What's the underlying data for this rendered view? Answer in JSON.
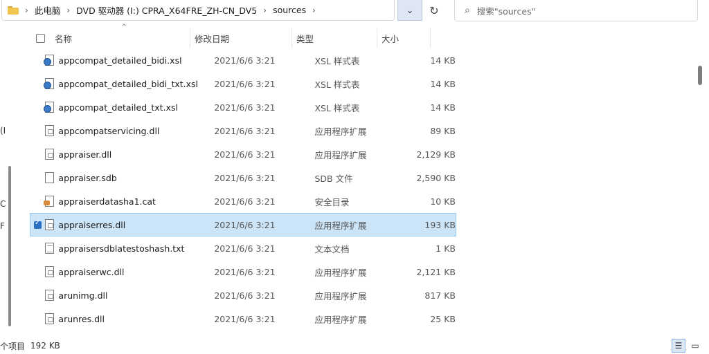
{
  "address_bar": {
    "crumbs": [
      "此电脑",
      "DVD 驱动器 (I:) CPRA_X64FRE_ZH-CN_DV5",
      "sources"
    ]
  },
  "search": {
    "placeholder": "搜索\"sources\""
  },
  "nav_fragments": [
    "(I",
    "C",
    "F"
  ],
  "columns": {
    "name": "名称",
    "date": "修改日期",
    "type": "类型",
    "size": "大小"
  },
  "files": [
    {
      "name": "appcompat_detailed_bidi.xsl",
      "date": "2021/6/6 3:21",
      "type": "XSL 样式表",
      "size": "14 KB",
      "icon": "xsl-stylesheet-icon"
    },
    {
      "name": "appcompat_detailed_bidi_txt.xsl",
      "date": "2021/6/6 3:21",
      "type": "XSL 样式表",
      "size": "14 KB",
      "icon": "xsl-stylesheet-icon"
    },
    {
      "name": "appcompat_detailed_txt.xsl",
      "date": "2021/6/6 3:21",
      "type": "XSL 样式表",
      "size": "14 KB",
      "icon": "xsl-stylesheet-icon"
    },
    {
      "name": "appcompatservicing.dll",
      "date": "2021/6/6 3:21",
      "type": "应用程序扩展",
      "size": "89 KB",
      "icon": "dll-file-icon"
    },
    {
      "name": "appraiser.dll",
      "date": "2021/6/6 3:21",
      "type": "应用程序扩展",
      "size": "2,129 KB",
      "icon": "dll-file-icon"
    },
    {
      "name": "appraiser.sdb",
      "date": "2021/6/6 3:21",
      "type": "SDB 文件",
      "size": "2,590 KB",
      "icon": "blank-file-icon"
    },
    {
      "name": "appraiserdatasha1.cat",
      "date": "2021/6/6 3:21",
      "type": "安全目录",
      "size": "10 KB",
      "icon": "security-catalog-icon"
    },
    {
      "name": "appraiserres.dll",
      "date": "2021/6/6 3:21",
      "type": "应用程序扩展",
      "size": "193 KB",
      "icon": "dll-file-icon",
      "selected": true
    },
    {
      "name": "appraisersdblatestoshash.txt",
      "date": "2021/6/6 3:21",
      "type": "文本文档",
      "size": "1 KB",
      "icon": "text-file-icon"
    },
    {
      "name": "appraiserwc.dll",
      "date": "2021/6/6 3:21",
      "type": "应用程序扩展",
      "size": "2,121 KB",
      "icon": "dll-file-icon"
    },
    {
      "name": "arunimg.dll",
      "date": "2021/6/6 3:21",
      "type": "应用程序扩展",
      "size": "817 KB",
      "icon": "dll-file-icon"
    },
    {
      "name": "arunres.dll",
      "date": "2021/6/6 3:21",
      "type": "应用程序扩展",
      "size": "25 KB",
      "icon": "dll-file-icon"
    }
  ],
  "status": {
    "count_text": "个项目",
    "size_text": "192 KB"
  },
  "view_buttons": {
    "details": "details-view-icon",
    "thumbnails": "large-icons-view-icon"
  }
}
